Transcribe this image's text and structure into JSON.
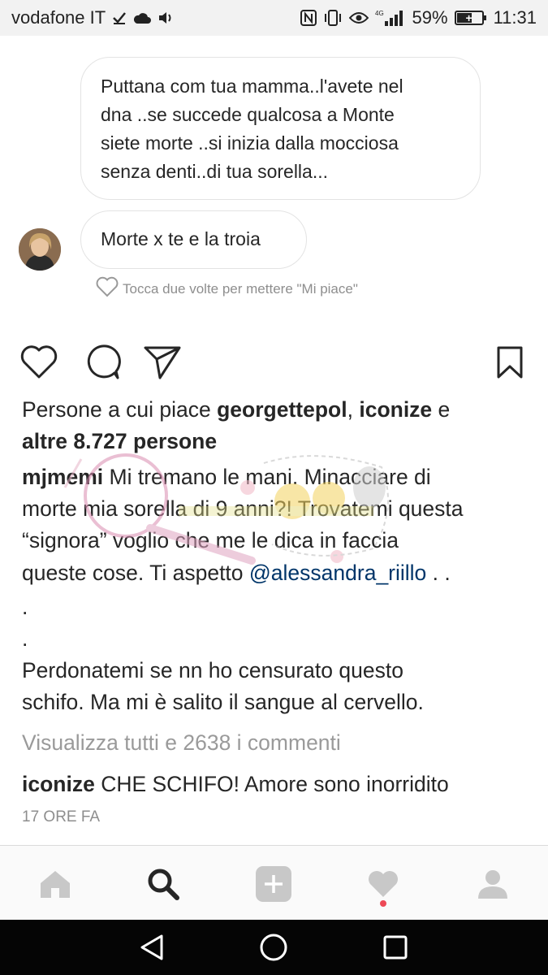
{
  "status_bar": {
    "carrier": "vodafone IT",
    "network": "4G",
    "battery_percent_text": "59%",
    "battery_level": 0.59,
    "time": "11:31",
    "icons": [
      "check-icon",
      "cloud-icon",
      "volume-icon",
      "nfc-icon",
      "vibrate-icon",
      "eye-icon",
      "signal-icon",
      "battery-icon"
    ]
  },
  "chat": {
    "message_1_lines": [
      "Puttana com tua mamma..l'avete  nel",
      "dna ..se succede qualcosa a Monte",
      "siete morte ..si inizia dalla mocciosa",
      "senza denti..di tua sorella..."
    ],
    "message_2": "Morte x te e la troia",
    "like_hint": "Tocca due volte per mettere \"Mi piace\""
  },
  "post": {
    "likes_prefix": "Persone a cui piace ",
    "liker_1": "georgettepol",
    "likes_comma": ", ",
    "liker_2": "iconize",
    "likes_and": " e",
    "likes_others": "altre 8.727 persone",
    "caption": {
      "username": "mjmemi",
      "line_1": " Mi tremano le mani. Minacciare di",
      "line_2": "morte mia sorella di 9 anni?! Trovatemi questa",
      "line_3": "“signora” voglio che me le dica in faccia",
      "line_4_prefix": "queste cose. Ti aspetto ",
      "mention": "@alessandra_riillo",
      "line_4_suffix": " . .",
      "dot_1": ".",
      "dot_2": ".",
      "line_5": "Perdonatemi se nn ho censurato questo",
      "line_6": "schifo. Ma mi è salito il sangue al cervello."
    },
    "view_comments": "Visualizza tutti e 2638 i commenti",
    "comment": {
      "username": "iconize",
      "text": " CHE SCHIFO! Amore sono inorridito"
    },
    "timestamp": "17 ORE FA"
  },
  "tab_bar": {
    "tabs": [
      "home-icon",
      "search-icon",
      "add-post-icon",
      "activity-heart-icon",
      "profile-icon"
    ],
    "active": "search-icon",
    "notification_dot_color": "#ed4956"
  },
  "colors": {
    "mention": "#003569",
    "muted": "#9a9a9a",
    "text": "#262626"
  }
}
